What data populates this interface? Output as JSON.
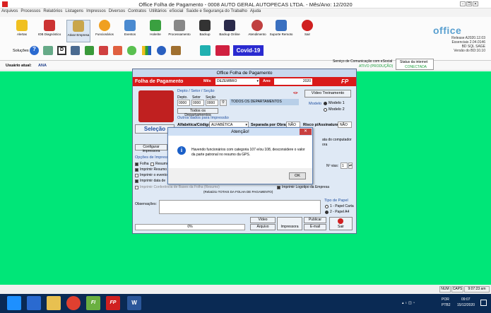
{
  "window": {
    "title": "Office Folha de Pagamento - 0008 AUTO GERAL AUTOPECAS LTDA. - Mês/Ano: 12/2020"
  },
  "menu": [
    "Arquivos",
    "Processos",
    "Relatórios",
    "Listagens",
    "Impressos",
    "Diversos",
    "Contratos",
    "Utilitários",
    "eSocial",
    "Saúde e Segurança do Trabalho",
    "Ajuda"
  ],
  "toolbar": {
    "row1": [
      "Alertas",
      "IOB Diagnóstico",
      "Ativar Empresa",
      "Funcionários",
      "Eventos",
      "Holerite",
      "Processamento",
      "Backup",
      "Backup Online",
      "Atendimento",
      "Suporte Remoto",
      "Sair"
    ],
    "solucoes_label": "Soluções",
    "covid_label": "Covid-19"
  },
  "brand": {
    "name": "office",
    "versions": [
      "Release A2020.12.03",
      "Essenciais 2.04.0146",
      "BD SQL SAGE",
      "Versão do BD:10.10"
    ]
  },
  "userbar": {
    "label": "Usuário atual:",
    "user": "ANA",
    "esocial": "Serviço de Comunicação com eSocial",
    "esocial_status": "ATIVO (PRODUÇÃO)",
    "internet": "Status da internet",
    "internet_status": "CONECTADA"
  },
  "main": {
    "title": "Office Folha de Pagamento",
    "header": "Folha de Pagamento",
    "mes_label": "Mês",
    "mes": "DEZEMBRO",
    "ano_label": "Ano",
    "ano": "2020",
    "fp": "FP",
    "depto_title": "Depto / Setor / Seção",
    "depto_labels": [
      "Depto.",
      "Setor",
      "Seção"
    ],
    "depto_values": [
      "0000",
      "0000",
      "0000"
    ],
    "depto_desc": "TODOS OS DEPARTAMENTOS",
    "todos_btn": "Todos os Departamentos",
    "video_btn": "Vídeo Treinamento",
    "modelo_label": "Modelo",
    "modelos": [
      "Modelo 1",
      "Modelo 2"
    ],
    "outros_title": "Outros dados para Impressão",
    "ordem_label": "Alfabética/Código",
    "ordem_value": "ALFABÉTICA",
    "obras_label": "Separada por Obras",
    "obras_value": "NÃO",
    "risco_label": "Risco p/Assinatura",
    "risco_value": "NÃO",
    "selecao": "Seleção",
    "config_btn": "Configurar impressora",
    "opcoes_title": "Opções de Impressão",
    "opcoes": [
      "Folha",
      "Imprimir Resumo",
      "Imprimir o evento",
      "Imprimir data de"
    ],
    "resumo_label": "Resumo",
    "computador": "ata do computador",
    "ora": "ora",
    "nvias_label": "Nº vias:",
    "nvias": "1",
    "conferencia": "Imprimir Conferência de Bases da Folha (Resumo)",
    "relatorio": "(Relatório TOTAIS DA FOLHA DE PAGAMENTO)",
    "logotipo": "Imprimir Logotipo da Empresa",
    "tipo_papel": "Tipo de Papel",
    "papeis": [
      "1 - Papel Carta",
      "2 - Papel A4"
    ],
    "obs_label": "Observações:",
    "progress": "0%",
    "btns": [
      "Vídeo",
      "Arquivo",
      "Impressora",
      "Publicar",
      "E-mail",
      "Sair"
    ]
  },
  "dialog": {
    "title": "Atenção!",
    "message": "Havendo funcionários com categoria 107 e/ou 108, desconsidere o valor da parte patronal no resumo da GPS.",
    "ok": "OK"
  },
  "status": {
    "num": "NUM",
    "caps": "CAPS",
    "time": "9:07:23 am"
  },
  "taskbar": {
    "lang": "POR",
    "kbd": "PTB2",
    "clock": "09:07",
    "date": "15/12/2020"
  }
}
